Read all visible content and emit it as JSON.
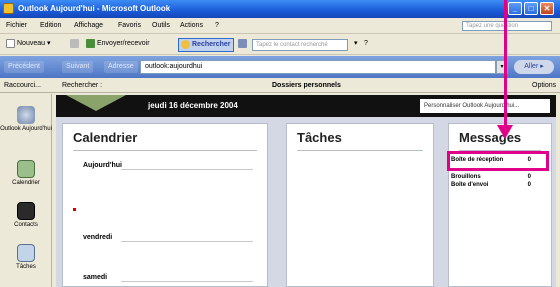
{
  "window": {
    "title": "Outlook Aujourd'hui - Microsoft Outlook",
    "min_label": "_",
    "max_label": "□",
    "close_label": "✕"
  },
  "menu": {
    "items": [
      "Fichier",
      "Edition",
      "Affichage",
      "Favoris",
      "Outils",
      "Actions",
      "?"
    ],
    "help_placeholder": "Tapez une question"
  },
  "toolbar": {
    "new_label": "Nouveau ▾",
    "send_receive_label": "Envoyer/recevoir",
    "search_label": "Rechercher",
    "contact_placeholder": "Tapez le contact recherché",
    "help_label": "?"
  },
  "address_bar": {
    "back_label": "Précédent",
    "forward_label": "Suivant",
    "address_label": "Adresse",
    "value": "outlook:aujourdhui",
    "go_label": "Aller ▸"
  },
  "nav_bar": {
    "left_label": "Raccourci...",
    "search_label": "Rechercher :",
    "filter_label": "Dossiers personnels",
    "options_label": "Options"
  },
  "sidebar": {
    "items": [
      {
        "label": "Outlook Aujourd'hui",
        "icon": "outlook-today-icon"
      },
      {
        "label": "Calendrier",
        "icon": "calendar-icon"
      },
      {
        "label": "Contacts",
        "icon": "contacts-icon"
      },
      {
        "label": "Tâches",
        "icon": "tasks-icon"
      }
    ]
  },
  "date_bar": {
    "date": "jeudi 16 décembre 2004",
    "customize_label": "Personnaliser Outlook Aujourd'hui..."
  },
  "calendar": {
    "title": "Calendrier",
    "days": [
      "Aujourd'hui",
      "vendredi",
      "samedi"
    ]
  },
  "tasks": {
    "title": "Tâches"
  },
  "messages": {
    "title": "Messages",
    "rows": [
      {
        "label": "Boîte de réception",
        "count": "0"
      },
      {
        "label": "Brouillons",
        "count": "0"
      },
      {
        "label": "Boîte d'envoi",
        "count": "0"
      }
    ]
  },
  "colors": {
    "annotation": "#e0008a",
    "titlebar": "#1a5bd8"
  }
}
